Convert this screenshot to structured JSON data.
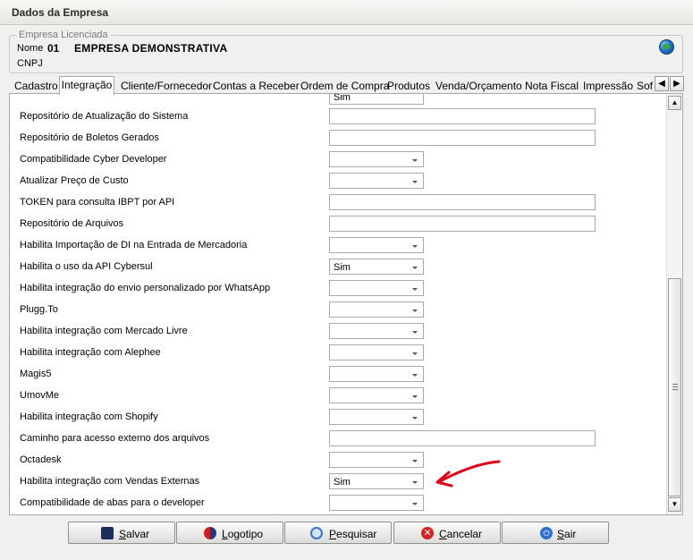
{
  "window": {
    "title": "Dados da Empresa"
  },
  "empresa": {
    "legend": "Empresa Licenciada",
    "nome_label": "Nome",
    "codigo": "01",
    "nome": "EMPRESA DEMONSTRATIVA",
    "cnpj_label": "CNPJ"
  },
  "tabs": [
    {
      "label": "Cadastro"
    },
    {
      "label": "Integração",
      "active": true
    },
    {
      "label": "Cliente/Fornecedor"
    },
    {
      "label": "Contas a Receber"
    },
    {
      "label": "Ordem de Compra"
    },
    {
      "label": "Produtos"
    },
    {
      "label": "Venda/Orçamento"
    },
    {
      "label": "Nota Fiscal"
    },
    {
      "label": "Impressão"
    },
    {
      "label": "Sof"
    }
  ],
  "form": {
    "partial_top_value": "Sim",
    "rows": [
      {
        "label": "Repositório de Atualização do Sistema",
        "type": "text",
        "value": ""
      },
      {
        "label": "Repositório de Boletos Gerados",
        "type": "text",
        "value": ""
      },
      {
        "label": "Compatibilidade Cyber Developer",
        "type": "combo",
        "value": ""
      },
      {
        "label": "Atualizar Preço de Custo",
        "type": "combo",
        "value": ""
      },
      {
        "label": "TOKEN para consulta IBPT por API",
        "type": "text",
        "value": ""
      },
      {
        "label": "Repositório de Arquivos",
        "type": "text",
        "value": ""
      },
      {
        "label": "Habilita Importação de DI na Entrada de Mercadoria",
        "type": "combo",
        "value": ""
      },
      {
        "label": "Habilita o uso da API Cybersul",
        "type": "combo",
        "value": "Sim"
      },
      {
        "label": "Habilita integração do envio personalizado por WhatsApp",
        "type": "combo",
        "value": ""
      },
      {
        "label": "Plugg.To",
        "type": "combo",
        "value": ""
      },
      {
        "label": "Habilita integração com Mercado Livre",
        "type": "combo",
        "value": ""
      },
      {
        "label": "Habilita integração com Alephee",
        "type": "combo",
        "value": ""
      },
      {
        "label": "Magis5",
        "type": "combo",
        "value": ""
      },
      {
        "label": "UmovMe",
        "type": "combo",
        "value": ""
      },
      {
        "label": "Habilita integração com Shopify",
        "type": "combo",
        "value": ""
      },
      {
        "label": "Caminho para acesso externo dos arquivos",
        "type": "text",
        "value": ""
      },
      {
        "label": "Octadesk",
        "type": "combo",
        "value": ""
      },
      {
        "label": "Habilita integração com Vendas Externas",
        "type": "combo",
        "value": "Sim"
      },
      {
        "label": "Compatibilidade de abas para o developer",
        "type": "combo",
        "value": ""
      }
    ]
  },
  "buttons": {
    "salvar": "Salvar",
    "logotipo": "Logotipo",
    "pesquisar": "Pesquisar",
    "cancelar": "Cancelar",
    "sair": "Sair"
  },
  "colors": {
    "annotation_arrow": "#e0001a",
    "cancel_icon": "#d42020",
    "exit_icon": "#2f6fd0"
  }
}
